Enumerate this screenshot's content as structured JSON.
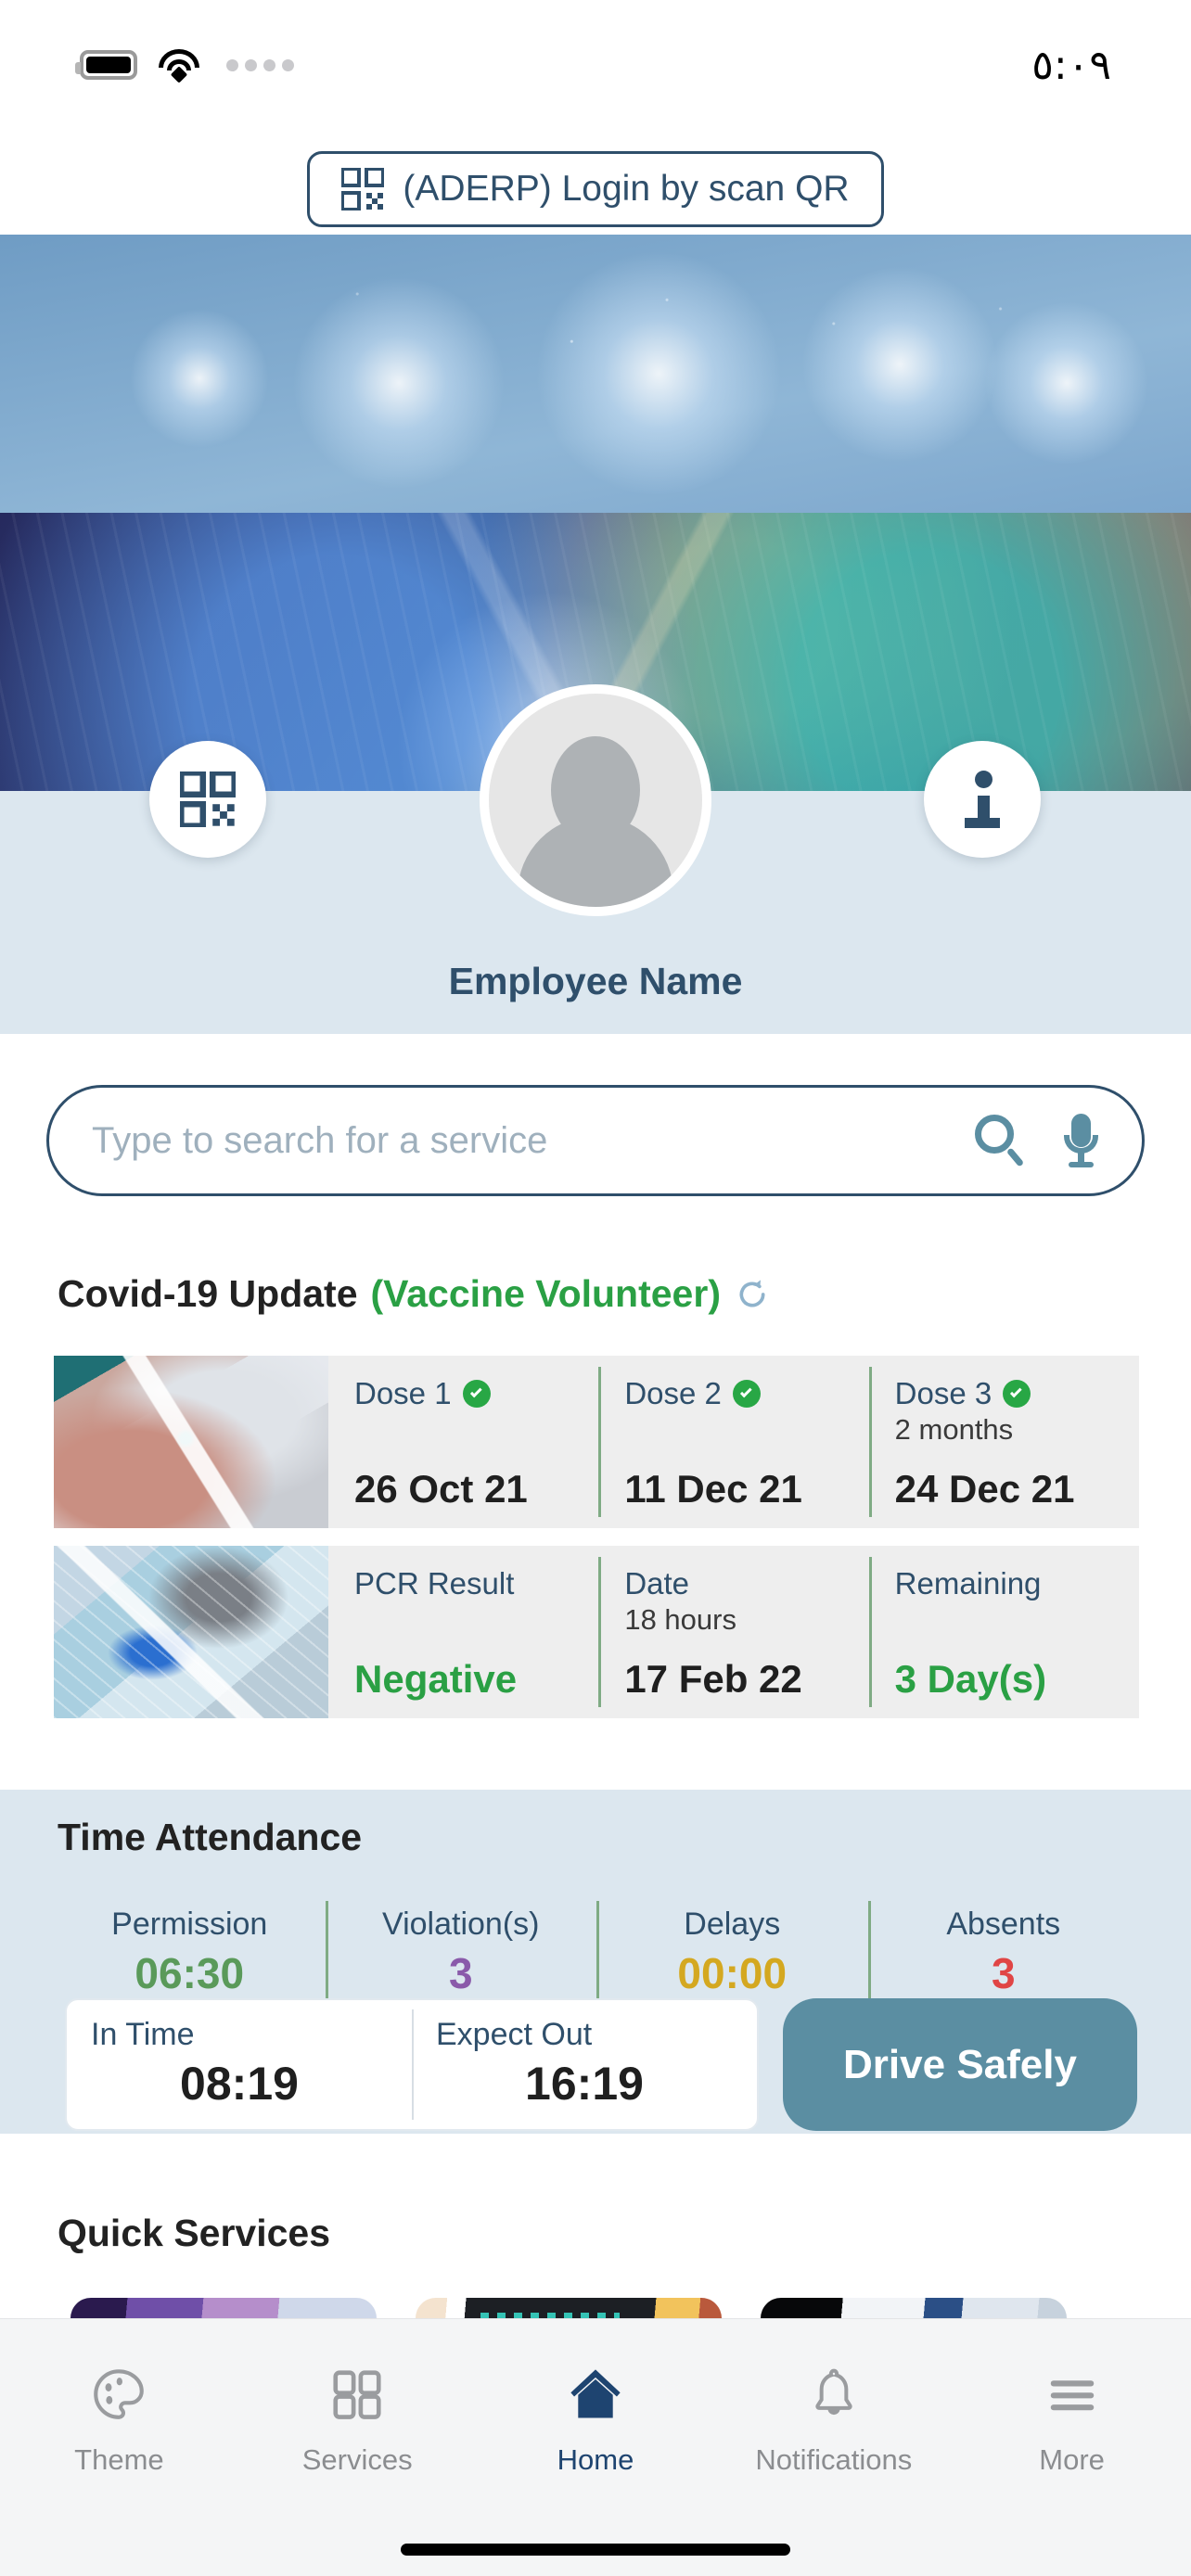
{
  "status_bar": {
    "time": "٥:٠٩",
    "battery_icon": "battery-icon",
    "wifi_icon": "wifi-icon",
    "signal_icon": "signal-dots-icon"
  },
  "top_action": {
    "qr_icon": "qr-code-icon",
    "label": "(ADERP) Login by scan QR"
  },
  "profile": {
    "qr_button_icon": "qr-code-icon",
    "info_button_icon": "info-icon",
    "avatar_icon": "avatar-placeholder-icon",
    "name": "Employee Name"
  },
  "search": {
    "placeholder": "Type to search for a service",
    "value": "",
    "search_icon": "search-icon",
    "mic_icon": "microphone-icon"
  },
  "covid": {
    "title": "Covid-19 Update",
    "subtitle": "(Vaccine Volunteer)",
    "refresh_icon": "refresh-icon",
    "dose_row": {
      "thumb_icon": "vaccination-photo",
      "items": [
        {
          "label": "Dose 1",
          "verified": true,
          "sub": "",
          "value": "26 Oct 21",
          "value_color": "black"
        },
        {
          "label": "Dose 2",
          "verified": true,
          "sub": "",
          "value": "11 Dec 21",
          "value_color": "black"
        },
        {
          "label": "Dose 3",
          "verified": true,
          "sub": "2 months",
          "value": "24 Dec 21",
          "value_color": "black"
        }
      ]
    },
    "pcr_row": {
      "thumb_icon": "pcr-test-photo",
      "items": [
        {
          "label": "PCR Result",
          "verified": false,
          "sub": "",
          "value": "Negative",
          "value_color": "green"
        },
        {
          "label": "Date",
          "verified": false,
          "sub": "18 hours",
          "value": "17 Feb 22",
          "value_color": "black"
        },
        {
          "label": "Remaining",
          "verified": false,
          "sub": "",
          "value": "3 Day(s)",
          "value_color": "green"
        }
      ]
    }
  },
  "time_attendance": {
    "title": "Time Attendance",
    "stats": [
      {
        "label": "Permission",
        "value": "06:30",
        "color": "#5a9a5a"
      },
      {
        "label": "Violation(s)",
        "value": "3",
        "color": "#8a5aaa"
      },
      {
        "label": "Delays",
        "value": "00:00",
        "color": "#d4a820"
      },
      {
        "label": "Absents",
        "value": "3",
        "color": "#e04545"
      }
    ],
    "in_time": {
      "label": "In Time",
      "value": "08:19"
    },
    "expect_out": {
      "label": "Expect Out",
      "value": "16:19"
    },
    "drive_button": "Drive Safely"
  },
  "quick_services": {
    "title": "Quick Services",
    "cards": [
      {
        "name": "quick-service-card-1"
      },
      {
        "name": "quick-service-card-2"
      },
      {
        "name": "quick-service-card-3"
      }
    ]
  },
  "bottom_nav": {
    "items": [
      {
        "label": "Theme",
        "icon": "palette-icon",
        "active": false
      },
      {
        "label": "Services",
        "icon": "grid-icon",
        "active": false
      },
      {
        "label": "Home",
        "icon": "home-icon",
        "active": true
      },
      {
        "label": "Notifications",
        "icon": "bell-icon",
        "active": false
      },
      {
        "label": "More",
        "icon": "hamburger-icon",
        "active": false
      }
    ]
  },
  "colors": {
    "brand_navy": "#2f4f6b",
    "accent_teal": "#5b8ea2",
    "success_green": "#2aa044",
    "band_blue": "#dce7ef",
    "active_nav": "#1e4470"
  }
}
